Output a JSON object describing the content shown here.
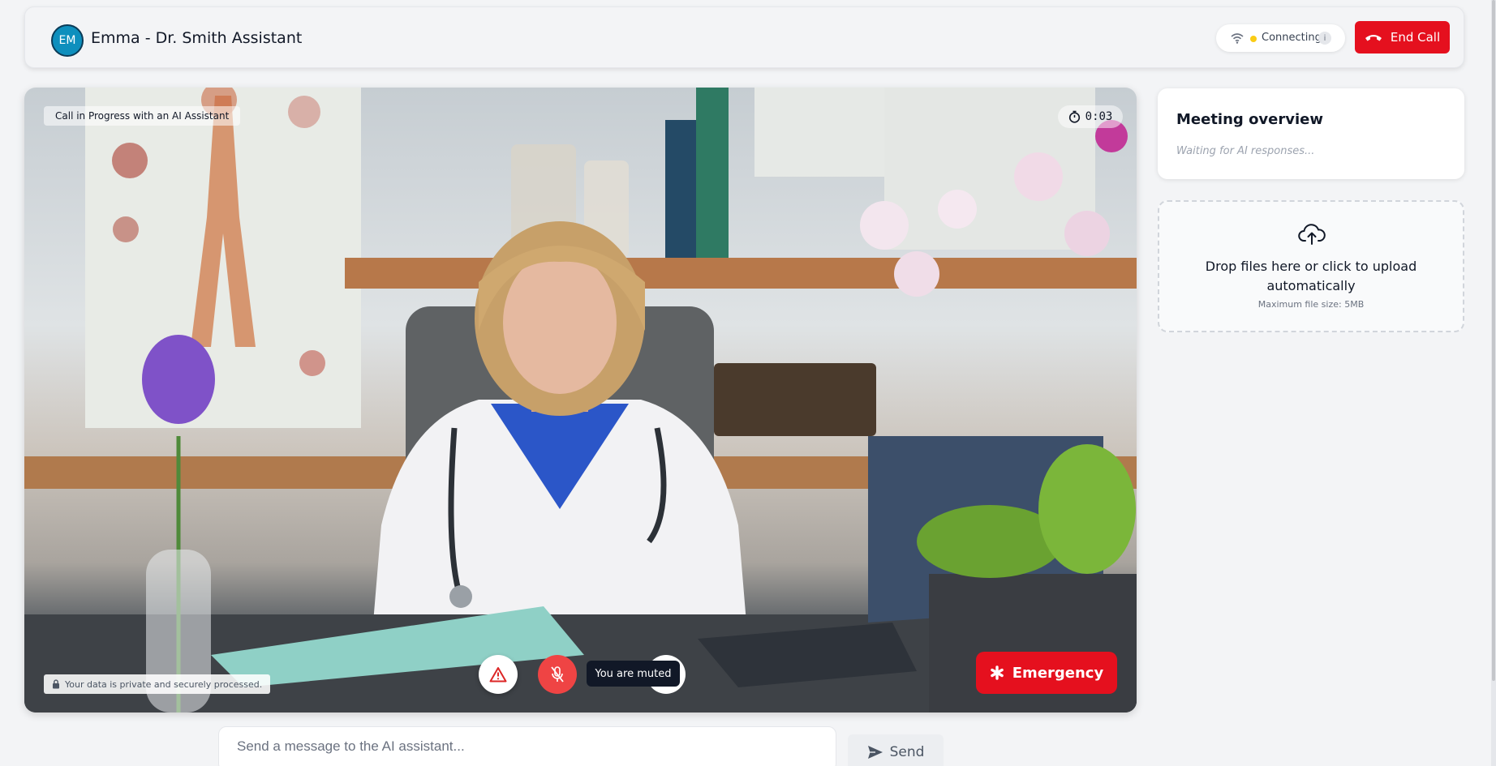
{
  "header": {
    "avatar_initials": "EM",
    "title": "Emma - Dr. Smith Assistant",
    "status_text": "Connecting",
    "status_info_glyph": "i",
    "end_call_label": "End Call"
  },
  "video": {
    "call_label": "Call in Progress with an AI Assistant",
    "timer": "0:03",
    "privacy_note": "Your data is private and securely processed.",
    "muted_tooltip": "You are muted",
    "emergency_label": "Emergency"
  },
  "overview": {
    "title": "Meeting overview",
    "status": "Waiting for AI responses..."
  },
  "upload": {
    "text": "Drop files here or click to upload automatically",
    "hint": "Maximum file size: 5MB"
  },
  "message": {
    "placeholder": "Send a message to the AI assistant...",
    "send_label": "Send"
  },
  "colors": {
    "danger": "#e5101e",
    "mic_muted": "#ef4444",
    "status_connecting": "#facc15",
    "avatar": "#0e8fbd"
  },
  "icons": [
    "wifi-icon",
    "info-icon",
    "phone-hangup-icon",
    "stopwatch-icon",
    "lock-icon",
    "warning-icon",
    "mic-off-icon",
    "camera-icon",
    "asterisk-icon",
    "cloud-upload-icon",
    "send-icon"
  ]
}
